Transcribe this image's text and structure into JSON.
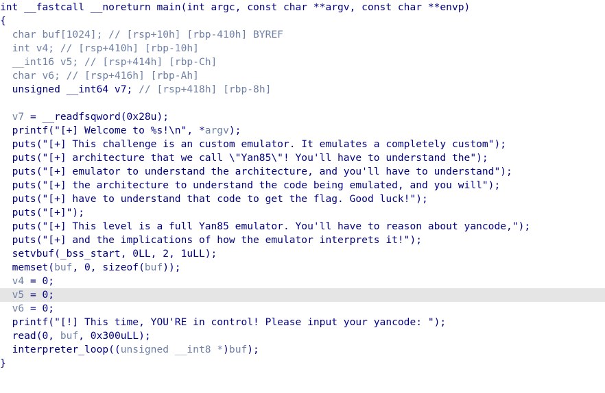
{
  "colors": {
    "code_text": "#000080",
    "variable_and_comment": "#6e80a6",
    "highlight_background": "#e5e5e5",
    "background": "#ffffff"
  },
  "code": {
    "highlighted_line": 21,
    "lines": [
      [
        {
          "t": "int __fastcall __noreturn main(int argc, const char **argv, const char **envp)",
          "c": "plain"
        }
      ],
      [
        {
          "t": "{",
          "c": "plain"
        }
      ],
      [
        {
          "t": "  char buf[1024]; ",
          "c": "dim"
        },
        {
          "t": "// [rsp+10h] [rbp-410h] BYREF",
          "c": "cmt"
        }
      ],
      [
        {
          "t": "  int v4; ",
          "c": "dim"
        },
        {
          "t": "// [rsp+410h] [rbp-10h]",
          "c": "cmt"
        }
      ],
      [
        {
          "t": "  __int16 v5; ",
          "c": "dim"
        },
        {
          "t": "// [rsp+414h] [rbp-Ch]",
          "c": "cmt"
        }
      ],
      [
        {
          "t": "  char v6; ",
          "c": "dim"
        },
        {
          "t": "// [rsp+416h] [rbp-Ah]",
          "c": "cmt"
        }
      ],
      [
        {
          "t": "  unsigned __int64 v7; ",
          "c": "plain"
        },
        {
          "t": "// [rsp+418h] [rbp-8h]",
          "c": "cmt"
        }
      ],
      [
        {
          "t": "",
          "c": "plain"
        }
      ],
      [
        {
          "t": "  v7",
          "c": "dim"
        },
        {
          "t": " = __readfsqword(0x28u);",
          "c": "plain"
        }
      ],
      [
        {
          "t": "  printf(\"[+] Welcome to %s!\\n\", *",
          "c": "plain"
        },
        {
          "t": "argv",
          "c": "dim"
        },
        {
          "t": ");",
          "c": "plain"
        }
      ],
      [
        {
          "t": "  puts(\"[+] This challenge is an custom emulator. It emulates a completely custom\");",
          "c": "plain"
        }
      ],
      [
        {
          "t": "  puts(\"[+] architecture that we call \\\"Yan85\\\"! You'll have to understand the\");",
          "c": "plain"
        }
      ],
      [
        {
          "t": "  puts(\"[+] emulator to understand the architecture, and you'll have to understand\");",
          "c": "plain"
        }
      ],
      [
        {
          "t": "  puts(\"[+] the architecture to understand the code being emulated, and you will\");",
          "c": "plain"
        }
      ],
      [
        {
          "t": "  puts(\"[+] have to understand that code to get the flag. Good luck!\");",
          "c": "plain"
        }
      ],
      [
        {
          "t": "  puts(\"[+]\");",
          "c": "plain"
        }
      ],
      [
        {
          "t": "  puts(\"[+] This level is a full Yan85 emulator. You'll have to reason about yancode,\");",
          "c": "plain"
        }
      ],
      [
        {
          "t": "  puts(\"[+] and the implications of how the emulator interprets it!\");",
          "c": "plain"
        }
      ],
      [
        {
          "t": "  setvbuf(_bss_start, 0LL, 2, 1uLL);",
          "c": "plain"
        }
      ],
      [
        {
          "t": "  memset(",
          "c": "plain"
        },
        {
          "t": "buf",
          "c": "dim"
        },
        {
          "t": ", 0, sizeof(",
          "c": "plain"
        },
        {
          "t": "buf",
          "c": "dim"
        },
        {
          "t": "));",
          "c": "plain"
        }
      ],
      [
        {
          "t": "  v4",
          "c": "dim"
        },
        {
          "t": " = 0;",
          "c": "plain"
        }
      ],
      [
        {
          "t": "  v5",
          "c": "dim"
        },
        {
          "t": " = 0;",
          "c": "plain"
        }
      ],
      [
        {
          "t": "  v6",
          "c": "dim"
        },
        {
          "t": " = 0;",
          "c": "plain"
        }
      ],
      [
        {
          "t": "  printf(\"[!] This time, YOU'RE in control! Please input your yancode: \");",
          "c": "plain"
        }
      ],
      [
        {
          "t": "  read(0, ",
          "c": "plain"
        },
        {
          "t": "buf",
          "c": "dim"
        },
        {
          "t": ", 0x300uLL);",
          "c": "plain"
        }
      ],
      [
        {
          "t": "  interpreter_loop((",
          "c": "plain"
        },
        {
          "t": "unsigned __int8 *",
          "c": "dim"
        },
        {
          "t": ")",
          "c": "plain"
        },
        {
          "t": "buf",
          "c": "dim"
        },
        {
          "t": ");",
          "c": "plain"
        }
      ],
      [
        {
          "t": "}",
          "c": "plain"
        }
      ]
    ]
  }
}
